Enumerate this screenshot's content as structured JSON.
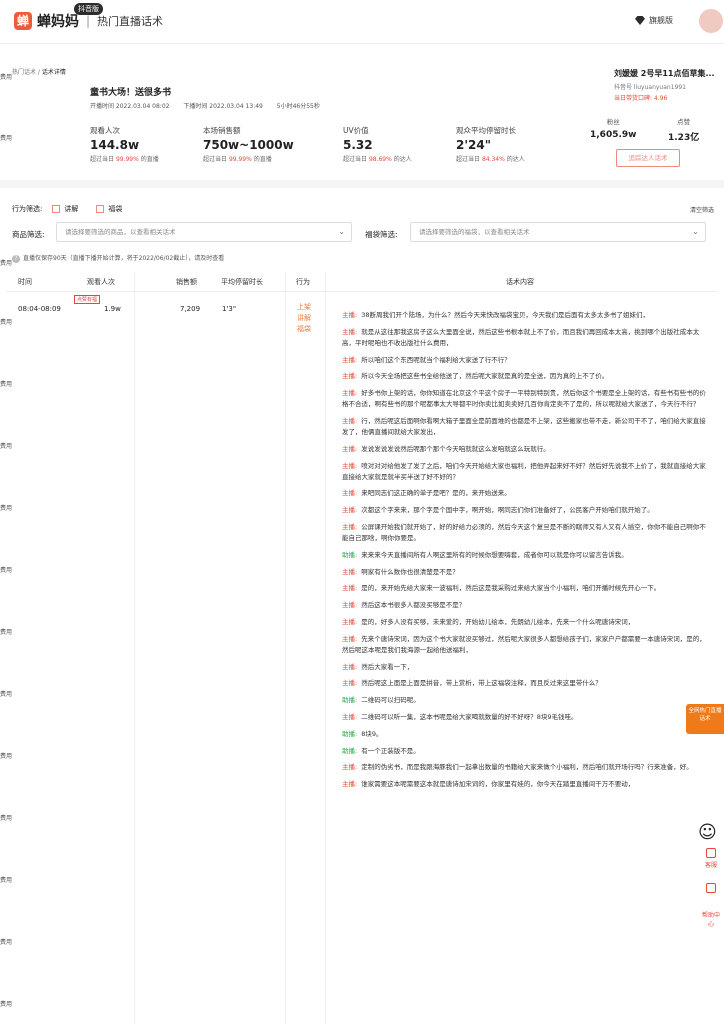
{
  "header": {
    "logo_text": "蝉妈妈",
    "logo_badge": "抖音版",
    "section": "热门直播话术",
    "vip": "旗舰版"
  },
  "side_labels": [
    "费用"
  ],
  "breadcrumb": {
    "parent": "热门话术",
    "current": "话术详情"
  },
  "live": {
    "title": "童书大场！送很多书",
    "start": "开播时间 2022.03.04 08:02",
    "end": "下播时间 2022.03.04 13:49",
    "duration": "5小时46分55秒"
  },
  "stats": [
    {
      "label": "观看人次",
      "value": "144.8w",
      "sub": "超过当日",
      "pct": "99.99%",
      "tail": "的直播"
    },
    {
      "label": "本场销售额",
      "value": "750w~1000w",
      "sub": "超过当日",
      "pct": "99.99%",
      "tail": "的直播"
    },
    {
      "label": "UV价值",
      "value": "5.32",
      "sub": "超过当日",
      "pct": "98.69%",
      "tail": "的达人"
    },
    {
      "label": "观众平均停留时长",
      "value": "2'24\"",
      "sub": "超过当日",
      "pct": "84.34%",
      "tail": "的达人"
    }
  ],
  "anchor": {
    "name": "刘媛媛 2号早11点佰草集...",
    "id": "抖音号 liuyuanyuan1991",
    "praise": "当日带货口碑: 4.96"
  },
  "fans": {
    "label": "粉丝",
    "value": "1,605.9w"
  },
  "likes": {
    "label": "点赞",
    "value": "1.23亿"
  },
  "track_button": "追踪达人话术",
  "filters": {
    "action_label": "行为筛选:",
    "opt1": "讲解",
    "opt2": "福袋",
    "clear": "清空筛选",
    "goods_label": "商品筛选:",
    "goods_placeholder": "请选择要筛选的商品，以查看相关话术",
    "bag_label": "福袋筛选:",
    "bag_placeholder": "请选择要筛选的福袋，以查看相关话术"
  },
  "note": "直播仅保存90天（直播下播开始计算，将于2022/06/02截止），请及时查看",
  "table": {
    "headers": [
      "时间",
      "观看人次",
      "销售额",
      "平均停留时长",
      "行为",
      "话术内容"
    ],
    "row": {
      "time": "08:04-08:09",
      "hot": "点赞有福",
      "views": "1.9w",
      "sales": "7,209",
      "stay": "1'3\"",
      "actions": [
        "上架",
        "讲解",
        "福袋"
      ]
    },
    "lines": [
      {
        "who": "主播:",
        "text": "38断周我们开个陆场，为什么？然后今天来快改福袋宝贝，今天我们是后面有太多太多书了姐妹们，"
      },
      {
        "who": "主播:",
        "text": "就是从这往那我这房子这么大里面全说，然后这些书根本就上不了价，而且我们再回成本太高，挑到哪个出版社成本太高，平时呢咱也不收出版社什么费用，"
      },
      {
        "who": "主播:",
        "text": "所以咱们这个东西呢就当个福利给大家送了行不行？"
      },
      {
        "who": "主播:",
        "text": "所以今天全场把这些书全给他送了，然后呢大家就是真的是全送，因为真的上不了价。"
      },
      {
        "who": "主播:",
        "text": "好多书你上架的话，你你知道在北京这个平这个房子一平特别特别贵，然后你这个书要是全上架的话，有些书有些书的价格不合适，啊有些书的那个呢都事太大导都平时你卖比如卖卖好几百你肯定卖不了是的，所以呢就给大家送了，今天行不行？"
      },
      {
        "who": "主播:",
        "text": "行，然后呢这后面啊你看啊大箱子里面全是前面堆的也都是不上架，这些搬家也带不走，新公司干不了，咱们给大家直接发了，他俩直播间就给大家发出，"
      },
      {
        "who": "主播:",
        "text": "发说发说发说然后呢那个那个今天咱就就这么发咱就这么玩就行。"
      },
      {
        "who": "主播:",
        "text": "喷对对对给他发了发了之后，咱们今天开始给大家也福利，把他弄起来好不好？然后好先说我不上价了，我就直接给大家直接给大家就是就半买半送了好不好的？"
      },
      {
        "who": "主播:",
        "text": "来吧同志们这正确的单子是吧？是的，来开始送来。"
      },
      {
        "who": "主播:",
        "text": "次都这个字来来，那个字是个国中字，啊开始，啊同志们你们准备好了，公民客户开始咱们就开始了。"
      },
      {
        "who": "主播:",
        "text": "公屏课开始我们就开始了，好的好给力必须的，然后今天这个复旦是不断的瞎师又有人又有人插空，你你不能自己啊你不能自己那啥，啊你你要是。"
      },
      {
        "who": "助播:",
        "text": "来来来今天直播间所有人啊这里所有的时候你想要嗨套，成者你可以就是你可以留言告诉我。"
      },
      {
        "who": "主播:",
        "text": "啊家有什么数你也很清楚是不是？"
      },
      {
        "who": "主播:",
        "text": "是的，来开始先给大家来一波福利，然后这是我采购过来给大家当个小福利，咱们开播时候先开心一下。"
      },
      {
        "who": "主播:",
        "text": "然后这本书很多人都没买够是不是？"
      },
      {
        "who": "主播:",
        "text": "是的，好多人没有买够，未来爱的，开始幼儿绘本，先朗幼儿绘本，先来一个什么呢唐诗宋词，"
      },
      {
        "who": "主播:",
        "text": "先来个唐诗宋词，因为这个书大家就没买够过，然后呢大家很多人都想给孩子们，家家户户都需要一本唐诗宋词，是的，然后呢这本呢是我们我海源一起给他送福利，"
      },
      {
        "who": "主播:",
        "text": "然后大家看一下，"
      },
      {
        "who": "主播:",
        "text": "然后呢这上面是上面是拼音，带上赏析，带上这福袋注释，而且反过来这里带什么？"
      },
      {
        "who": "助播:",
        "text": "二维码可以扫码呢。"
      },
      {
        "who": "主播:",
        "text": "二维码可以听一集，这本书呢是给大家喝就数量的好不好呀？8块9毛钱哇。"
      },
      {
        "who": "助播:",
        "text": "8块9。"
      },
      {
        "who": "助播:",
        "text": "有一个正装版不是。"
      },
      {
        "who": "主播:",
        "text": "定制的伪劣书，而是我跟海豚我们一起拿出数量的书籍给大家来做个小福利，然后咱们就开场行吗？行来准备，好。"
      },
      {
        "who": "主播:",
        "text": "谁家需要这本呢需要这本就是唐诗加宋词的，你家里有娃的，你今天在踏里直播间干万不要动，"
      }
    ]
  },
  "fab": {
    "hot": "全网热门直播话术",
    "service": "客服",
    "help": "帮助中心"
  }
}
